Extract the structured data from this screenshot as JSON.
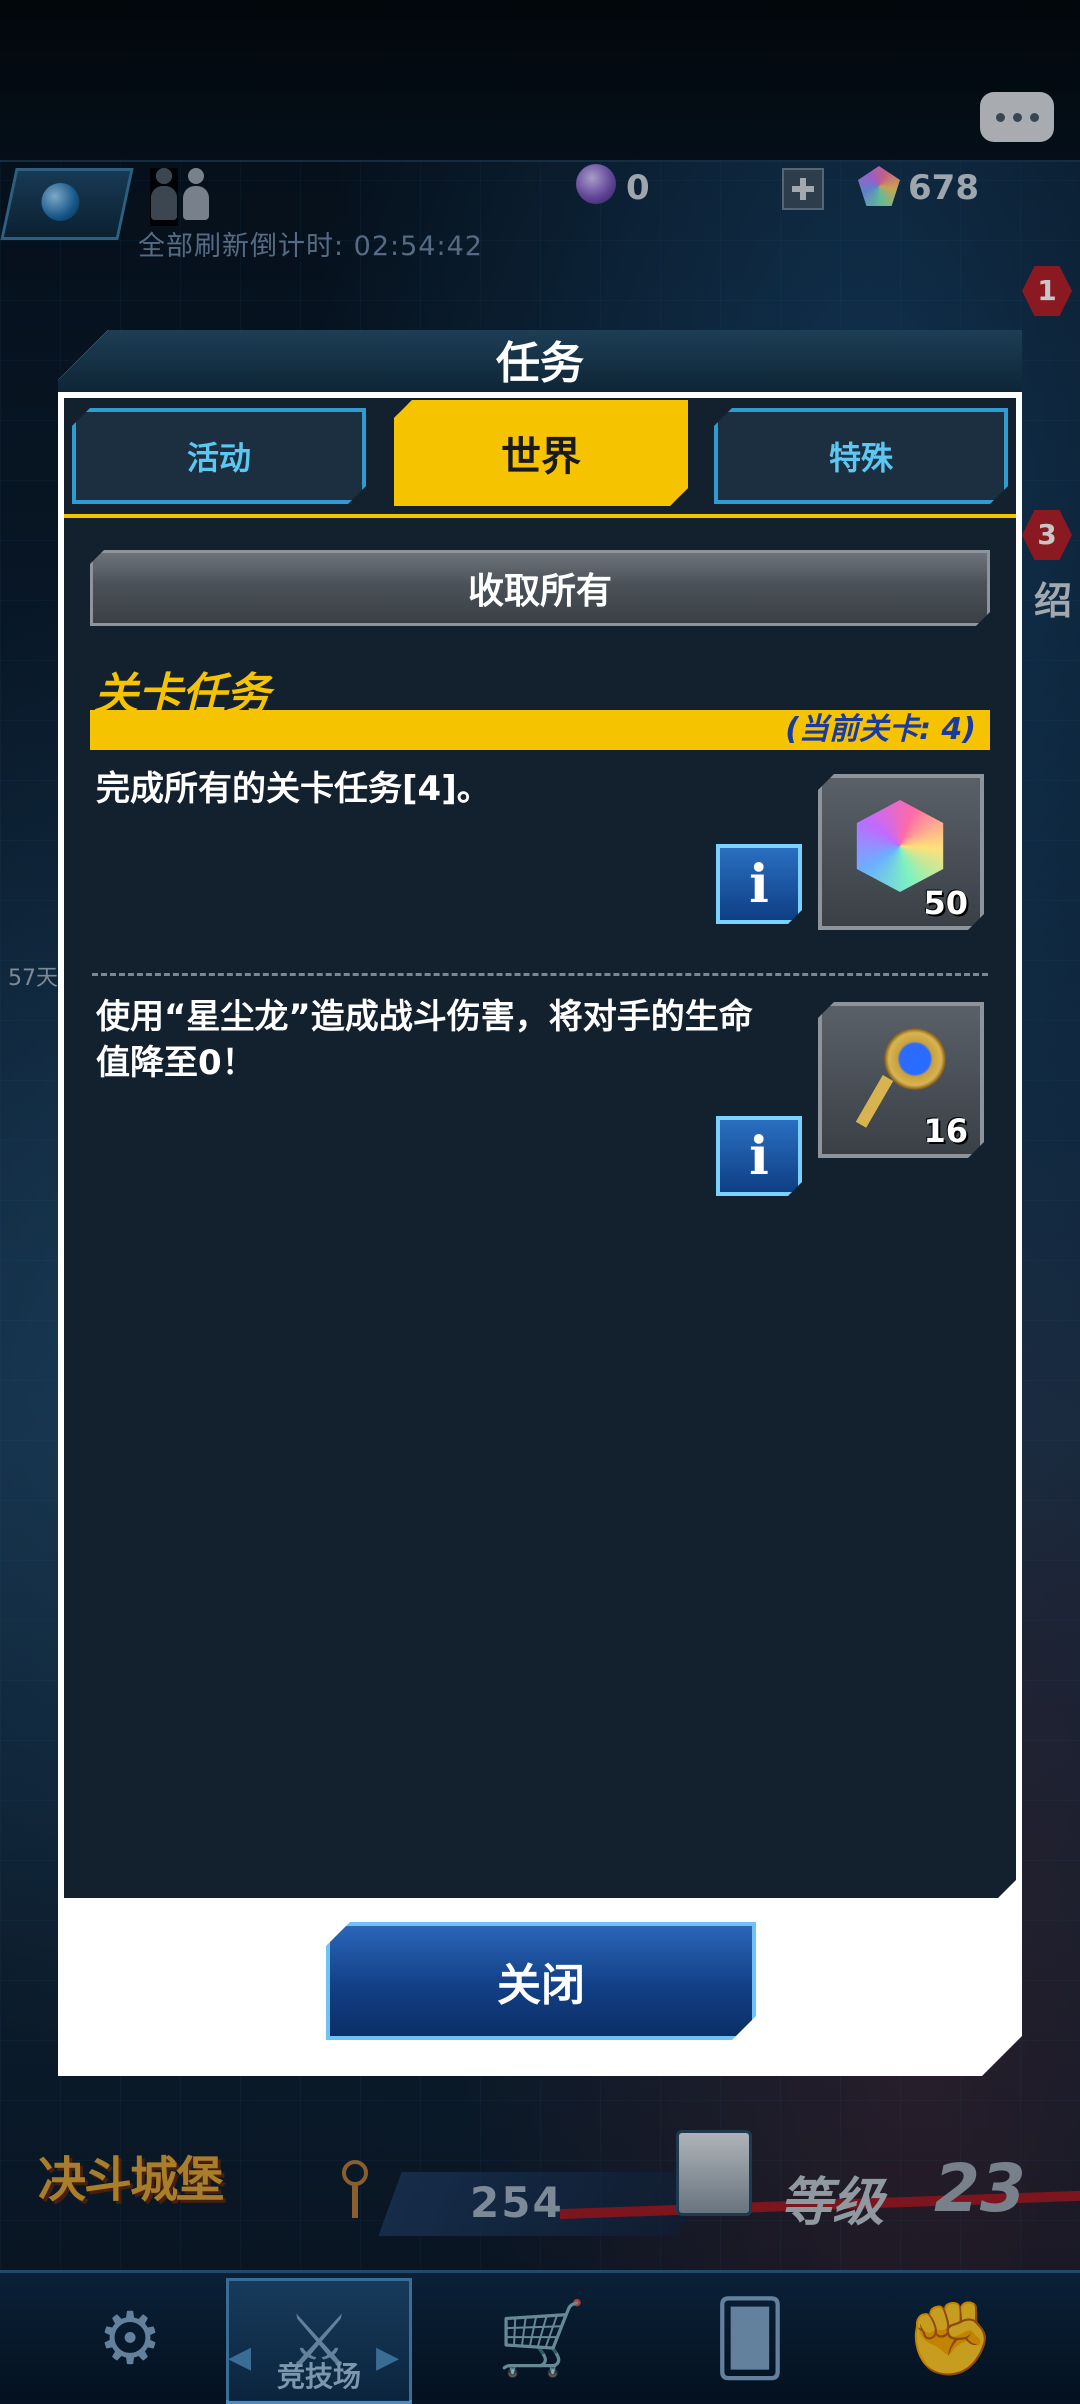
{
  "top_bar": {
    "countdown": "全部刷新倒计时: 02:54:42",
    "orb_count": "0",
    "gem_count": "678",
    "badge_top": "1",
    "badge_mid": "3",
    "side_label": "绍",
    "side_days": "57天"
  },
  "modal": {
    "title": "任务",
    "tabs": [
      {
        "label": "活动",
        "active": false
      },
      {
        "label": "世界",
        "active": true
      },
      {
        "label": "特殊",
        "active": false
      }
    ],
    "collect_all": "收取所有",
    "section": {
      "title": "关卡任务",
      "current_stage": "(当前关卡: 4)"
    },
    "missions": [
      {
        "text": "完成所有的关卡任务[4]。",
        "reward_icon": "gem-icon",
        "reward_count": "50"
      },
      {
        "text": "使用“星尘龙”造成战斗伤害，将对手的生命值降至0！",
        "reward_icon": "key-icon",
        "reward_count": "16"
      }
    ],
    "info_label": "i",
    "close_label": "关闭"
  },
  "hud": {
    "logo": "决斗城堡",
    "key_count": "254",
    "level_label": "等级",
    "level_value": "23"
  },
  "bottom_nav": {
    "arena_label": "竞技场"
  },
  "colors": {
    "accent_yellow": "#f5c300",
    "tab_blue": "#2f9bd0",
    "panel_bg": "#13202d",
    "stage_text": "#1a3aa0"
  }
}
